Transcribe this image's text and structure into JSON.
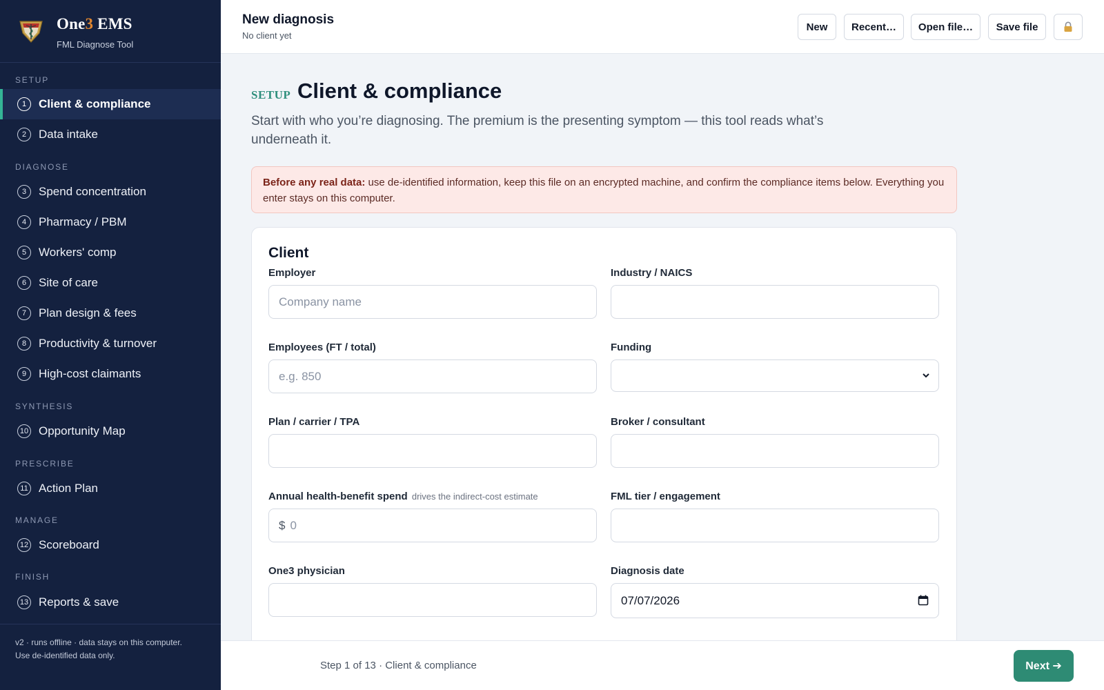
{
  "brand": {
    "name_prefix": "One",
    "name_accent": "3",
    "name_suffix": " EMS",
    "subtitle": "FML Diagnose Tool",
    "logo_icon": "caduceus-shield-icon"
  },
  "sidebar": {
    "sections": [
      {
        "label": "SETUP",
        "items": [
          {
            "num": "1",
            "label": "Client & compliance",
            "active": true
          },
          {
            "num": "2",
            "label": "Data intake"
          }
        ]
      },
      {
        "label": "DIAGNOSE",
        "items": [
          {
            "num": "3",
            "label": "Spend concentration"
          },
          {
            "num": "4",
            "label": "Pharmacy / PBM"
          },
          {
            "num": "5",
            "label": "Workers' comp"
          },
          {
            "num": "6",
            "label": "Site of care"
          },
          {
            "num": "7",
            "label": "Plan design & fees"
          },
          {
            "num": "8",
            "label": "Productivity & turnover"
          },
          {
            "num": "9",
            "label": "High-cost claimants"
          }
        ]
      },
      {
        "label": "SYNTHESIS",
        "items": [
          {
            "num": "10",
            "label": "Opportunity Map"
          }
        ]
      },
      {
        "label": "PRESCRIBE",
        "items": [
          {
            "num": "11",
            "label": "Action Plan"
          }
        ]
      },
      {
        "label": "MANAGE",
        "items": [
          {
            "num": "12",
            "label": "Scoreboard"
          }
        ]
      },
      {
        "label": "FINISH",
        "items": [
          {
            "num": "13",
            "label": "Reports & save"
          }
        ]
      }
    ],
    "footer_line1": "v2 · runs offline · data stays on this computer.",
    "footer_line2": "Use de-identified data only."
  },
  "header": {
    "title": "New diagnosis",
    "subtitle": "No client yet",
    "buttons": {
      "new": "New",
      "recent": "Recent…",
      "open": "Open file…",
      "save": "Save file",
      "lock_icon": "lock-icon"
    }
  },
  "page": {
    "eyebrow": "SETUP",
    "title": "Client & compliance",
    "lead": "Start with who you’re diagnosing. The premium is the presenting symptom — this tool reads what’s underneath it.",
    "alert_bold": "Before any real data:",
    "alert_text": " use de-identified information, keep this file on an encrypted machine, and confirm the compliance items below. Everything you enter stays on this computer."
  },
  "form": {
    "title": "Client",
    "employer": {
      "label": "Employer",
      "placeholder": "Company name",
      "value": ""
    },
    "industry": {
      "label": "Industry / NAICS",
      "value": ""
    },
    "employees": {
      "label": "Employees (FT / total)",
      "placeholder": "e.g. 850",
      "value": ""
    },
    "funding": {
      "label": "Funding",
      "value": ""
    },
    "plan": {
      "label": "Plan / carrier / TPA",
      "value": ""
    },
    "broker": {
      "label": "Broker / consultant",
      "value": ""
    },
    "spend": {
      "label": "Annual health-benefit spend",
      "hint": "drives the indirect-cost estimate",
      "prefix": "$",
      "placeholder": "0",
      "value": ""
    },
    "tier": {
      "label": "FML tier / engagement",
      "value": ""
    },
    "physician": {
      "label": "One3 physician",
      "value": ""
    },
    "date": {
      "label": "Diagnosis date",
      "value": "07/07/2026"
    }
  },
  "footer": {
    "step": "Step 1 of 13 · Client & compliance",
    "next": "Next ➔"
  },
  "colors": {
    "sidebar_bg": "#14213f",
    "accent_green": "#2e8b74",
    "brand_orange": "#e0862f",
    "alert_bg": "#fde9e7"
  }
}
